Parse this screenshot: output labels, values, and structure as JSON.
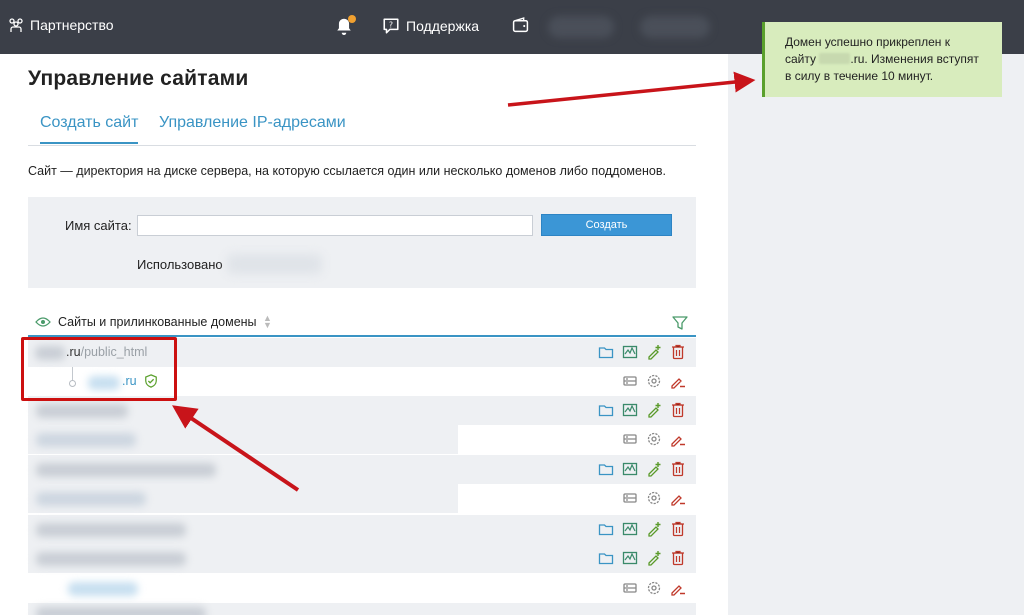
{
  "topbar": {
    "partnership": "Партнерство",
    "support": "Поддержка"
  },
  "page": {
    "title": "Управление сайтами",
    "tabs": [
      {
        "label": "Создать сайт",
        "active": true
      },
      {
        "label": "Управление IP-адресами",
        "active": false
      }
    ],
    "description": "Сайт — директория на диске сервера, на которую ссылается один или несколько доменов либо поддоменов."
  },
  "form": {
    "site_name_label": "Имя сайта:",
    "site_name_value": "",
    "create_button": "Создать",
    "used_label": "Использовано"
  },
  "sites_table": {
    "header": "Сайты и прилинкованные домены",
    "first_site": {
      "domain_suffix": ".ru",
      "path": "/public_html"
    },
    "first_domain": {
      "domain_suffix": ".ru"
    }
  },
  "toast": {
    "line1": "Домен успешно прикреплен к",
    "line2_prefix": "сайту",
    "line2_suffix": ".ru. Изменения вступят",
    "line3": "в силу в течение 10 минут."
  },
  "colors": {
    "topbar": "#3b3f48",
    "accent": "#3a94c4",
    "button": "#3b96d6",
    "annotation": "#cc1010",
    "toast_bg": "#d8ecbd"
  }
}
